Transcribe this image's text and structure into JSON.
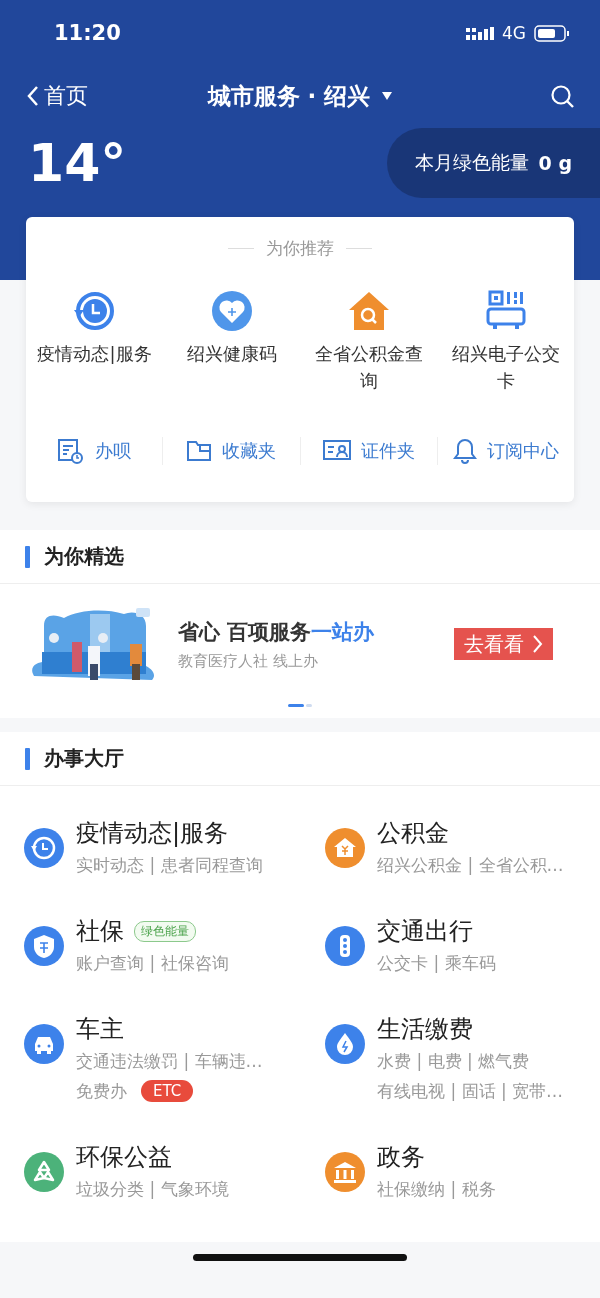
{
  "status_bar": {
    "time": "11:20",
    "network": "4G"
  },
  "nav": {
    "back": "首页",
    "title": "城市服务 · 绍兴"
  },
  "weather": {
    "temperature": "14°"
  },
  "green_energy": {
    "label": "本月绿色能量",
    "value": "0 g"
  },
  "recommend": {
    "title": "为你推荐",
    "items": [
      {
        "label": "疫情动态|服务"
      },
      {
        "label": "绍兴健康码"
      },
      {
        "label": "全省公积金查询"
      },
      {
        "label": "绍兴电子公交卡"
      }
    ],
    "shortcuts": [
      {
        "label": "办呗"
      },
      {
        "label": "收藏夹"
      },
      {
        "label": "证件夹"
      },
      {
        "label": "订阅中心"
      }
    ]
  },
  "featured": {
    "title": "为你精选",
    "banner": {
      "headline": "省心 百项服务",
      "headline_accent": "一站办",
      "subtitle": "教育医疗人社 线上办",
      "button": "去看看"
    },
    "pager": [
      {
        "selected": true
      },
      {
        "selected": false
      }
    ]
  },
  "hall": {
    "title": "办事大厅",
    "services": [
      {
        "name": "疫情动态|服务",
        "color": "#3d82ea",
        "lines": [
          {
            "text": "实时动态 | 患者同程查询"
          }
        ]
      },
      {
        "name": "公积金",
        "color": "#ef8e2e",
        "lines": [
          {
            "text": "绍兴公积金 | 全省公积…"
          }
        ]
      },
      {
        "name": "社保",
        "badge": "绿色能量",
        "color": "#3d82ea",
        "lines": [
          {
            "text": "账户查询 | 社保咨询"
          }
        ]
      },
      {
        "name": "交通出行",
        "color": "#3d82ea",
        "lines": [
          {
            "text": "公交卡 | 乘车码"
          }
        ]
      },
      {
        "name": "车主",
        "color": "#3d82ea",
        "lines": [
          {
            "text": "交通违法缴罚 | 车辆违…"
          },
          {
            "text": "免费办",
            "tag": "ETC"
          }
        ]
      },
      {
        "name": "生活缴费",
        "color": "#3d82ea",
        "lines": [
          {
            "text": "水费 | 电费 | 燃气费"
          },
          {
            "text": "有线电视 | 固话 | 宽带…"
          }
        ]
      },
      {
        "name": "环保公益",
        "color": "#4cb27a",
        "lines": [
          {
            "text": "垃圾分类 | 气象环境"
          }
        ]
      },
      {
        "name": "政务",
        "color": "#ef8e2e",
        "lines": [
          {
            "text": "社保缴纳 | 税务"
          }
        ]
      }
    ]
  }
}
